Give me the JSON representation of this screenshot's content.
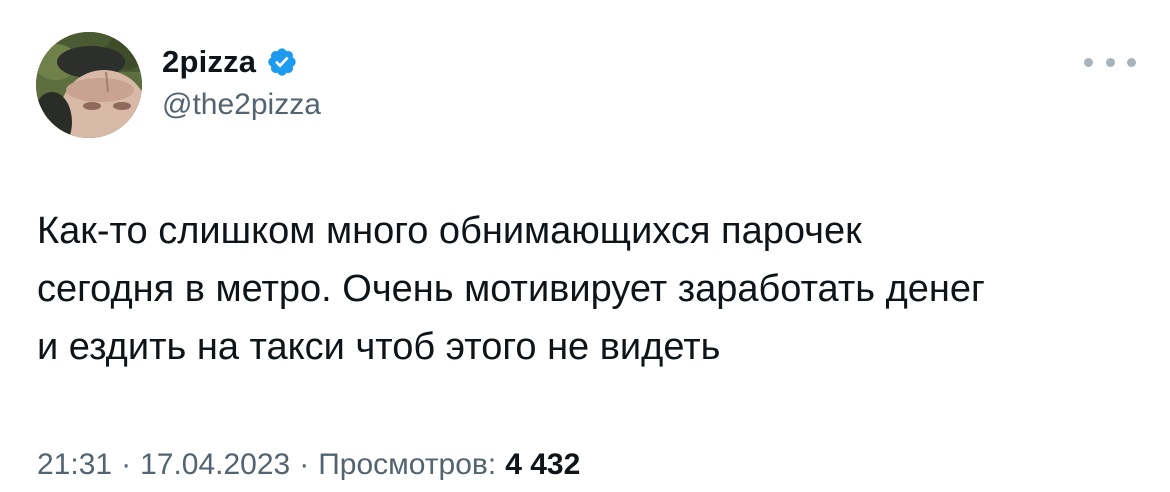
{
  "author": {
    "display_name": "2pizza",
    "handle": "@the2pizza",
    "verified": true,
    "avatar_icon": "profile-photo"
  },
  "more_icon": "more-horizontal-icon",
  "tweet": {
    "text": "Как-то слишком много обнимающихся парочек\nсегодня в метро. Очень мотивирует заработать денег\nи ездить на такси чтоб этого не видеть"
  },
  "meta": {
    "time": "21:31",
    "separator": "·",
    "date": "17.04.2023",
    "views_label": "Просмотров:",
    "views_count": "4 432"
  },
  "colors": {
    "text": "#0f1419",
    "secondary_text": "#536471",
    "verified_badge": "#1d9bf0",
    "more_dots": "#a8b3bc",
    "background": "#ffffff"
  }
}
